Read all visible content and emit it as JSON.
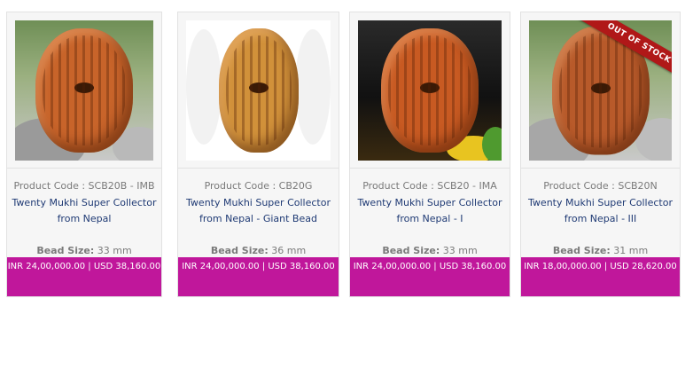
{
  "products": [
    {
      "code_label": "Product Code : SCB20B - IMB",
      "name": "Twenty Mukhi Super Collector from Nepal",
      "size_label": "Bead Size:",
      "size_value": "33 mm",
      "price": "INR 24,00,000.00 | USD 38,160.00",
      "image_desc": "rudraksha-bead-on-stones"
    },
    {
      "code_label": "Product Code : CB20G",
      "name": "Twenty Mukhi Super Collector from Nepal - Giant Bead",
      "size_label": "Bead Size:",
      "size_value": "36 mm",
      "price": "INR 24,00,000.00 | USD 38,160.00",
      "image_desc": "rudraksha-bead-white-background"
    },
    {
      "code_label": "Product Code : SCB20 - IMA",
      "name": "Twenty Mukhi Super Collector from Nepal - I",
      "size_label": "Bead Size:",
      "size_value": "33 mm",
      "price": "INR 24,00,000.00 | USD 38,160.00",
      "image_desc": "rudraksha-bead-dark-stones"
    },
    {
      "code_label": "Product Code : SCB20N",
      "name": "Twenty Mukhi Super Collector from Nepal - III",
      "size_label": "Bead Size:",
      "size_value": "31 mm",
      "price": "INR 18,00,000.00 | USD 28,620.00",
      "image_desc": "rudraksha-bead-on-stones",
      "ribbon": "OUT OF STOCK"
    }
  ],
  "colors": {
    "price_bar": "#c0179b",
    "name_text": "#1f3a74",
    "ribbon": "#b01818"
  }
}
